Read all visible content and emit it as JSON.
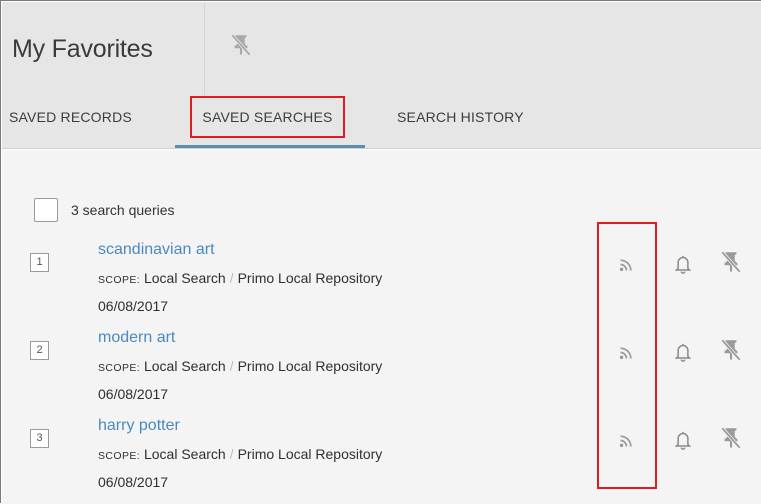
{
  "header": {
    "title": "My Favorites",
    "pin_icon": "unpin-icon"
  },
  "tabs": [
    {
      "label": "SAVED RECORDS",
      "active": false
    },
    {
      "label": "SAVED SEARCHES",
      "active": true
    },
    {
      "label": "SEARCH HISTORY",
      "active": false
    }
  ],
  "list": {
    "count_label": "3 search queries",
    "items": [
      {
        "number": "1",
        "title": "scandinavian art",
        "scope_label": "SCOPE:",
        "scope_a": "Local Search",
        "scope_sep": "/",
        "scope_b": "Primo Local Repository",
        "date": "06/08/2017"
      },
      {
        "number": "2",
        "title": "modern art",
        "scope_label": "SCOPE:",
        "scope_a": "Local Search",
        "scope_sep": "/",
        "scope_b": "Primo Local Repository",
        "date": "06/08/2017"
      },
      {
        "number": "3",
        "title": "harry potter",
        "scope_label": "SCOPE:",
        "scope_a": "Local Search",
        "scope_sep": "/",
        "scope_b": "Primo Local Repository",
        "date": "06/08/2017"
      }
    ],
    "actions": [
      "rss-icon",
      "bell-icon",
      "unpin-icon"
    ]
  },
  "colors": {
    "accent": "#4a8ac0",
    "highlight": "#e01b23",
    "tab_underline": "#5a8fb0",
    "header_bg": "#e6e6e6"
  }
}
